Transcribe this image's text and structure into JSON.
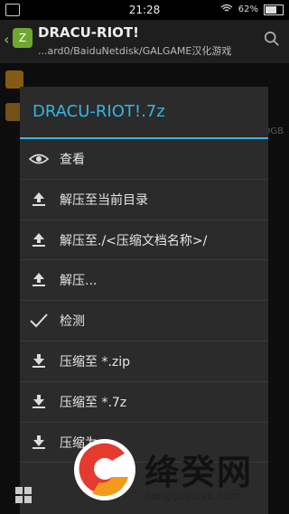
{
  "status_bar": {
    "time": "21:28",
    "battery": "62%"
  },
  "app_bar": {
    "title": "DRACU-RIOT!",
    "path": "...ard0/BaiduNetdisk/GALGAME汉化游戏"
  },
  "background": {
    "size_text": "0GB"
  },
  "dialog": {
    "title": "DRACU-RIOT!.7z",
    "items": [
      {
        "label": "查看",
        "icon": "eye-icon"
      },
      {
        "label": "解压至当前目录",
        "icon": "extract-icon"
      },
      {
        "label": "解压至./<压缩文档名称>/",
        "icon": "extract-icon"
      },
      {
        "label": "解压...",
        "icon": "extract-icon"
      },
      {
        "label": "检测",
        "icon": "check-icon"
      },
      {
        "label": "压缩至 *.zip",
        "icon": "compress-icon"
      },
      {
        "label": "压缩至 *.7z",
        "icon": "compress-icon"
      },
      {
        "label": "压缩为...",
        "icon": "compress-icon"
      }
    ]
  },
  "watermark": {
    "brand": "绛癸网",
    "url": "jiangguijiuye.com"
  },
  "colors": {
    "accent": "#33b5e5",
    "dialog_bg": "#2b2b2b",
    "app_logo": "#6fa82f"
  }
}
